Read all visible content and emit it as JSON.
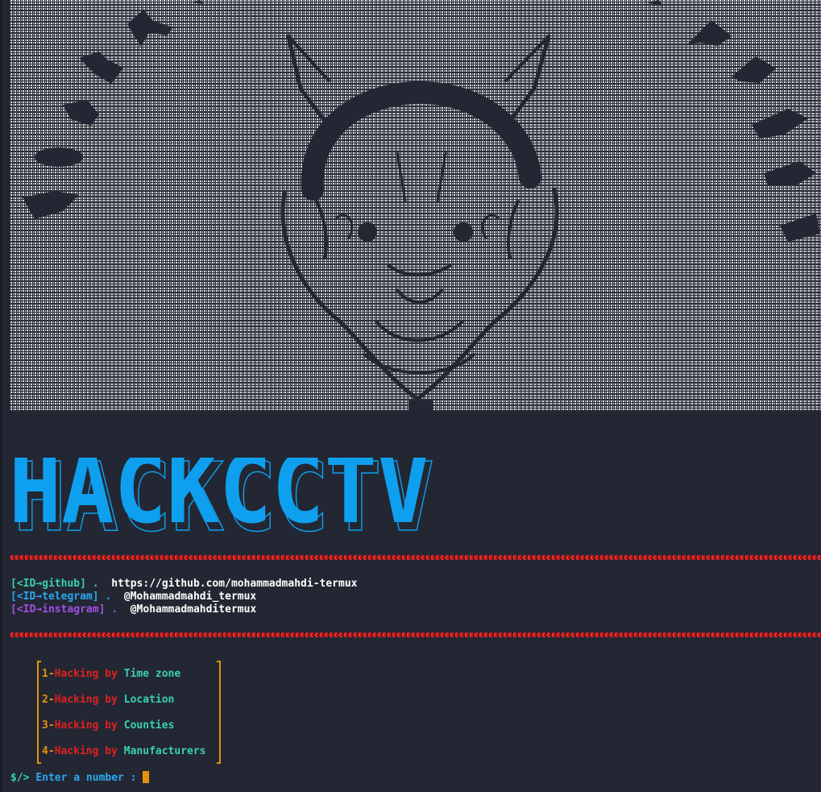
{
  "banner": {
    "title": "HACKCCTV",
    "color": "#0ea0ee"
  },
  "social": [
    {
      "label": "[<ID→github]",
      "separator": ".",
      "value": "https://github.com/mohammadmahdi-termux",
      "color": "#3ad0b0"
    },
    {
      "label": "[<ID→telegram]",
      "separator": ".",
      "value": "@Mohammadmahdi_termux",
      "color": "#2aa8f0"
    },
    {
      "label": "[<ID→instagram]",
      "separator": ".",
      "value": "@Mohammadmahditermux",
      "color": "#a44ee8"
    }
  ],
  "menu": [
    {
      "number": "1-",
      "action": "Hacking",
      "by": "by",
      "target": "Time zone"
    },
    {
      "number": "2-",
      "action": "Hacking",
      "by": "by",
      "target": "Location"
    },
    {
      "number": "3-",
      "action": "Hacking",
      "by": "by",
      "target": "Counties"
    },
    {
      "number": "4-",
      "action": "Hacking",
      "by": "by",
      "target": "Manufacturers"
    }
  ],
  "prompt": {
    "symbol": "$/>",
    "text": "Enter a number :"
  },
  "colors": {
    "background": "#232733",
    "divider": "#e02020",
    "accent": "#e8900c"
  }
}
